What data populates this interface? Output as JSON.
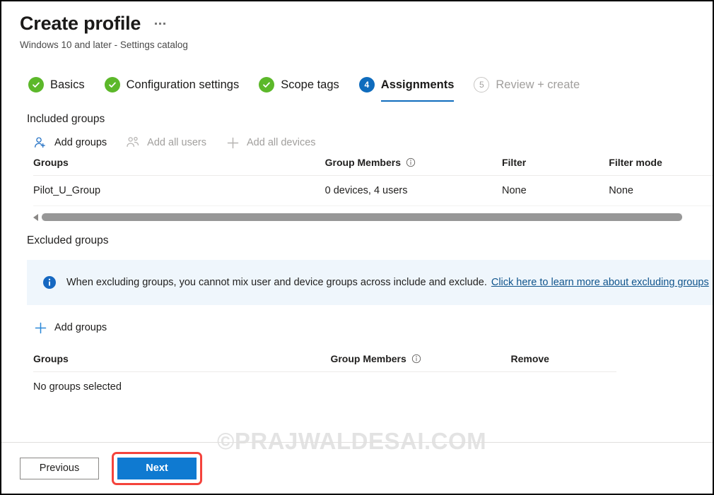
{
  "header": {
    "title": "Create profile",
    "subtitle": "Windows 10 and later - Settings catalog",
    "ellipsis_label": "..."
  },
  "wizard": {
    "steps": [
      {
        "number": "1",
        "label": "Basics",
        "state": "done"
      },
      {
        "number": "2",
        "label": "Configuration settings",
        "state": "done"
      },
      {
        "number": "3",
        "label": "Scope tags",
        "state": "done"
      },
      {
        "number": "4",
        "label": "Assignments",
        "state": "current"
      },
      {
        "number": "5",
        "label": "Review + create",
        "state": "todo"
      }
    ]
  },
  "included": {
    "heading": "Included groups",
    "commands": [
      {
        "label": "Add groups",
        "icon": "person-add-icon",
        "enabled": true
      },
      {
        "label": "Add all users",
        "icon": "people-icon",
        "enabled": false
      },
      {
        "label": "Add all devices",
        "icon": "plus-icon",
        "enabled": false
      }
    ],
    "columns": {
      "groups": "Groups",
      "members": "Group Members",
      "filter": "Filter",
      "filter_mode": "Filter mode"
    },
    "rows": [
      {
        "group": "Pilot_U_Group",
        "members": "0 devices, 4 users",
        "filter": "None",
        "filter_mode": "None"
      }
    ]
  },
  "excluded": {
    "heading": "Excluded groups",
    "banner": {
      "text": "When excluding groups, you cannot mix user and device groups across include and exclude.",
      "link": "Click here to learn more about excluding groups"
    },
    "add_groups_label": "Add groups",
    "columns": {
      "groups": "Groups",
      "members": "Group Members",
      "remove": "Remove"
    },
    "empty_text": "No groups selected"
  },
  "footer": {
    "previous_label": "Previous",
    "next_label": "Next"
  },
  "watermark": "©PRAJWALDESAI.COM",
  "colors": {
    "accent_blue": "#0f6cbd",
    "primary_button": "#0f7ad1",
    "success_green": "#5cb82a",
    "banner_bg": "#eff6fc",
    "link": "#0f548c",
    "highlight_red": "#f4433c",
    "disabled_text": "#a19f9d"
  }
}
